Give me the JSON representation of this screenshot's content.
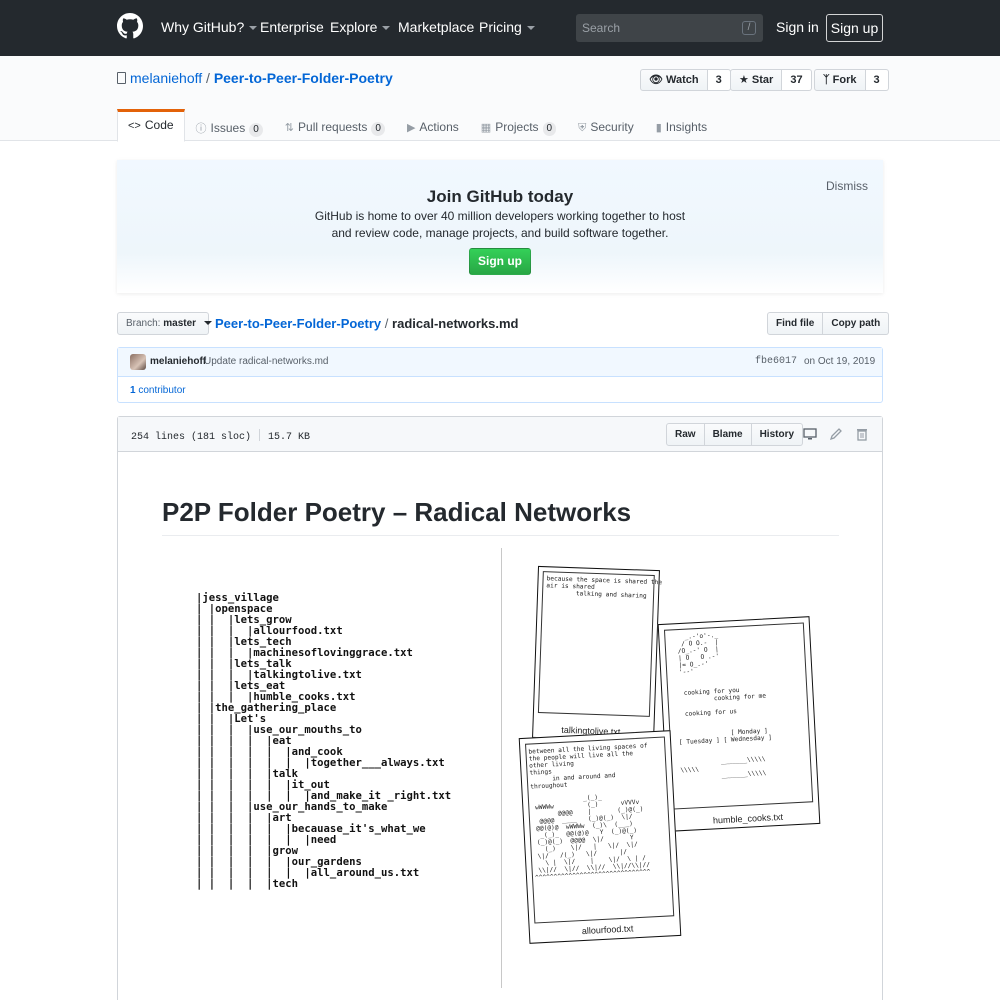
{
  "header": {
    "nav": [
      "Why GitHub?",
      "Enterprise",
      "Explore",
      "Marketplace",
      "Pricing"
    ],
    "search_placeholder": "Search",
    "search_key": "/",
    "sign_in": "Sign in",
    "sign_up": "Sign up"
  },
  "repo": {
    "owner": "melaniehoff",
    "separator": "/",
    "name": "Peer-to-Peer-Folder-Poetry",
    "watch_label": "Watch",
    "watch_count": "3",
    "star_label": "Star",
    "star_count": "37",
    "fork_label": "Fork",
    "fork_count": "3"
  },
  "tabs": [
    {
      "label": "Code",
      "icon": "code-icon"
    },
    {
      "label": "Issues",
      "count": "0",
      "icon": "issue-icon"
    },
    {
      "label": "Pull requests",
      "count": "0",
      "icon": "pull-request-icon"
    },
    {
      "label": "Actions",
      "icon": "play-icon"
    },
    {
      "label": "Projects",
      "count": "0",
      "icon": "project-icon"
    },
    {
      "label": "Security",
      "icon": "shield-icon"
    },
    {
      "label": "Insights",
      "icon": "graph-icon"
    }
  ],
  "banner": {
    "title": "Join GitHub today",
    "text": "GitHub is home to over 40 million developers working together to host and review code, manage projects, and build software together.",
    "button": "Sign up",
    "dismiss": "Dismiss"
  },
  "file_nav": {
    "branch_label": "Branch:",
    "branch": "master",
    "crumb_repo": "Peer-to-Peer-Folder-Poetry",
    "crumb_sep": "/",
    "crumb_file": "radical-networks.md",
    "find_file": "Find file",
    "copy_path": "Copy path"
  },
  "commit": {
    "author": "melaniehoff",
    "message": "Update radical-networks.md",
    "sha": "fbe6017",
    "date": "on Oct 19, 2019",
    "contributors_count": "1",
    "contributors_label": "contributor"
  },
  "file": {
    "lines": "254 lines (181 sloc)",
    "size": "15.7 KB",
    "raw": "Raw",
    "blame": "Blame",
    "history": "History",
    "md_title": "P2P Folder Poetry – Radical Networks"
  },
  "figure": {
    "tree_text": "|jess_village\n| |openspace\n| |  |lets_grow\n| |  |  |allourfood.txt\n| |  |lets_tech\n| |  |  |machinesoflovinggrace.txt\n| |  |lets_talk\n| |  |  |talkingtolive.txt\n| |  |lets_eat\n| |  |  |humble_cooks.txt\n| |the_gathering_place\n| |  |Let's\n| |  |  |use_our_mouths_to\n| |  |  |  |eat\n| |  |  |  |  |and_cook\n| |  |  |  |  |  |together___always.txt\n| |  |  |  |talk\n| |  |  |  |  |it_out\n| |  |  |  |  |  |and_make_it _right.txt\n| |  |  |use_our_hands_to_make\n| |  |  |  |art\n| |  |  |  |  |becauase_it's_what_we\n| |  |  |  |  |  |need\n| |  |  |  |grow\n| |  |  |  |  |our_gardens\n| |  |  |  |  |  |all_around_us.txt\n| |  |  |  |tech",
    "note1_text": "because the space is shared the\nair is shared\n        talking and sharing",
    "note1_caption": "talkingtolive.txt",
    "note2_text": "   _.-'o'-._\n  / O O.-  |\n /O_.-' O  |\n | O   O .-'\n |= O_.-'\n '--'\n\n\n  cooking for you\n          cooking for me\n\n  cooking for us\n\n\n              [ Monday ]\n[ Tuesday ] [ Wednesday ]\n\n\n           _______\\\\\\\\\\\n\\\\\\\\\\\n           _______\\\\\\\\\\",
    "note2_caption": "humble_cooks.txt",
    "note3_text": "between all the living spaces of\nthe people will live all the\nother living\nthings\n      in and around and\nthroughout\n\n              _(_)_\n wWWWw         (_)      vVVVv\n       @@@@    |       (_)@(_)\n  @@@@  ____   (_)@(_)  \\|/\n @@(@)@  wWWWw  (_)\\  (___)\n  _(_)_  @@(@)@   Y  (_)@(_)\n (_)@(_)  @@@@  \\|/       Y\n   (_)    \\|/   |   \\|/  \\|/\n \\|/   /(_)   \\|/      |/\n   \\ |  \\|/    |    \\|/  \\ | /\n \\\\|//  \\|//  \\\\|//  \\\\|//\\\\|//\n^^^^^^^^^^^^^^^^^^^^^^^^^^^^^^^",
    "note3_caption": "allourfood.txt"
  }
}
